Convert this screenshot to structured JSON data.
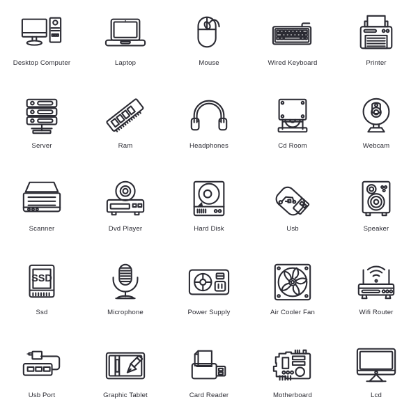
{
  "page": {
    "title": "Computer Hardware Icons",
    "background_color": "#ffffff",
    "stroke_color": "#2b2b33",
    "label_color": "#2b2b33",
    "grid": {
      "columns": 5,
      "rows": 5,
      "total_icons": 25
    }
  },
  "icons": [
    {
      "id": "desktop-computer",
      "label": "Desktop Computer",
      "icon_name": "desktop-computer-icon",
      "row": 1,
      "col": 1
    },
    {
      "id": "laptop",
      "label": "Laptop",
      "icon_name": "laptop-icon",
      "row": 1,
      "col": 2
    },
    {
      "id": "mouse",
      "label": "Mouse",
      "icon_name": "mouse-icon",
      "row": 1,
      "col": 3
    },
    {
      "id": "wired-keyboard",
      "label": "Wired Keyboard",
      "icon_name": "wired-keyboard-icon",
      "row": 1,
      "col": 4
    },
    {
      "id": "printer",
      "label": "Printer",
      "icon_name": "printer-icon",
      "row": 1,
      "col": 5
    },
    {
      "id": "server",
      "label": "Server",
      "icon_name": "server-icon",
      "row": 2,
      "col": 1
    },
    {
      "id": "ram",
      "label": "Ram",
      "icon_name": "ram-module-icon",
      "row": 2,
      "col": 2
    },
    {
      "id": "headphones",
      "label": "Headphones",
      "icon_name": "headphones-icon",
      "row": 2,
      "col": 3
    },
    {
      "id": "cd-room",
      "label": "Cd Room",
      "icon_name": "cd-rom-drive-icon",
      "row": 2,
      "col": 4
    },
    {
      "id": "webcam",
      "label": "Webcam",
      "icon_name": "webcam-icon",
      "row": 2,
      "col": 5
    },
    {
      "id": "scanner",
      "label": "Scanner",
      "icon_name": "scanner-icon",
      "row": 3,
      "col": 1
    },
    {
      "id": "dvd-player",
      "label": "Dvd Player",
      "icon_name": "dvd-player-icon",
      "row": 3,
      "col": 2
    },
    {
      "id": "hard-disk",
      "label": "Hard Disk",
      "icon_name": "hard-disk-icon",
      "row": 3,
      "col": 3
    },
    {
      "id": "usb",
      "label": "Usb",
      "icon_name": "usb-flash-drive-icon",
      "row": 3,
      "col": 4
    },
    {
      "id": "speaker",
      "label": "Speaker",
      "icon_name": "speaker-icon",
      "row": 3,
      "col": 5
    },
    {
      "id": "ssd",
      "label": "Ssd",
      "icon_name": "ssd-icon",
      "row": 4,
      "col": 1,
      "glyph_text": "SSD"
    },
    {
      "id": "microphone",
      "label": "Microphone",
      "icon_name": "microphone-icon",
      "row": 4,
      "col": 2
    },
    {
      "id": "power-supply",
      "label": "Power Supply",
      "icon_name": "power-supply-icon",
      "row": 4,
      "col": 3
    },
    {
      "id": "air-cooler-fan",
      "label": "Air Cooler Fan",
      "icon_name": "air-cooler-fan-icon",
      "row": 4,
      "col": 4
    },
    {
      "id": "wifi-router",
      "label": "Wifi Router",
      "icon_name": "wifi-router-icon",
      "row": 4,
      "col": 5
    },
    {
      "id": "usb-port",
      "label": "Usb Port",
      "icon_name": "usb-port-hub-icon",
      "row": 5,
      "col": 1
    },
    {
      "id": "graphic-tablet",
      "label": "Graphic Tablet",
      "icon_name": "graphic-tablet-icon",
      "row": 5,
      "col": 2
    },
    {
      "id": "card-reader",
      "label": "Card Reader",
      "icon_name": "card-reader-icon",
      "row": 5,
      "col": 3
    },
    {
      "id": "motherboard",
      "label": "Motherboard",
      "icon_name": "motherboard-icon",
      "row": 5,
      "col": 4
    },
    {
      "id": "lcd",
      "label": "Lcd",
      "icon_name": "lcd-monitor-icon",
      "row": 5,
      "col": 5
    }
  ]
}
